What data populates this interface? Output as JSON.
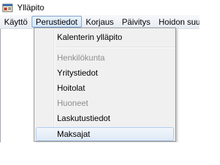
{
  "window": {
    "title": "Ylläpito",
    "icon": "app-window-icon"
  },
  "menubar": {
    "items": [
      {
        "label": "Käyttö"
      },
      {
        "label": "Perustiedot",
        "active": true
      },
      {
        "label": "Korjaus"
      },
      {
        "label": "Päivitys"
      },
      {
        "label": "Hoidon suu"
      }
    ]
  },
  "dropdown": {
    "items": [
      {
        "label": "Kalenterin ylläpito",
        "enabled": true
      },
      {
        "label": "Henkilökunta",
        "enabled": false
      },
      {
        "label": "Yritystiedot",
        "enabled": true
      },
      {
        "label": "Hoitolat",
        "enabled": true
      },
      {
        "label": "Huoneet",
        "enabled": false
      },
      {
        "label": "Laskutustiedot",
        "enabled": true
      },
      {
        "label": "Maksajat",
        "enabled": true,
        "highlighted": true
      }
    ]
  },
  "colors": {
    "menu_highlight_border": "#7da2ce",
    "disabled_text": "#8d8d8d",
    "menu_background": "#f0f0f0"
  }
}
